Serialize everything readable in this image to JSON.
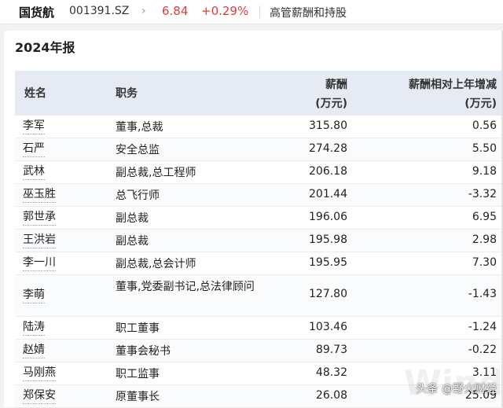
{
  "header": {
    "stock_name": "国货航",
    "stock_code": "001391.SZ",
    "price": "6.84",
    "change": "+0.29%",
    "section": "高管薪酬和持股"
  },
  "panel": {
    "title": "2024年报"
  },
  "table": {
    "headers": {
      "name": "姓名",
      "role": "职务",
      "pay": "薪酬\n(万元)",
      "delta": "薪酬相对上年增减\n(万元)"
    },
    "rows": [
      {
        "name": "李军",
        "role": "董事,总裁",
        "pay": "315.80",
        "delta": "0.56"
      },
      {
        "name": "石严",
        "role": "安全总监",
        "pay": "274.28",
        "delta": "5.50"
      },
      {
        "name": "武林",
        "role": "副总裁,总工程师",
        "pay": "206.18",
        "delta": "9.18"
      },
      {
        "name": "巫玉胜",
        "role": "总飞行师",
        "pay": "201.44",
        "delta": "-3.32"
      },
      {
        "name": "郭世承",
        "role": "副总裁",
        "pay": "196.06",
        "delta": "6.95"
      },
      {
        "name": "王洪岩",
        "role": "副总裁",
        "pay": "195.98",
        "delta": "2.98"
      },
      {
        "name": "李一川",
        "role": "副总裁,总会计师",
        "pay": "195.95",
        "delta": "7.30"
      },
      {
        "name": "李萌",
        "role": "董事,党委副书记,总法律顾问",
        "pay": "127.80",
        "delta": "-1.43"
      },
      {
        "name": "陆涛",
        "role": "职工董事",
        "pay": "103.46",
        "delta": "-1.24"
      },
      {
        "name": "赵婧",
        "role": "董事会秘书",
        "pay": "89.73",
        "delta": "-0.22"
      },
      {
        "name": "马刚燕",
        "role": "职工监事",
        "pay": "48.32",
        "delta": "3.11"
      },
      {
        "name": "郑保安",
        "role": "原董事长",
        "pay": "26.08",
        "delta": "25.09"
      }
    ]
  },
  "watermark": {
    "text": "头条 @野火财经",
    "bg_text": "Wind"
  },
  "colors": {
    "up": "#e4393c",
    "header_bg": "#e6ebf3"
  }
}
